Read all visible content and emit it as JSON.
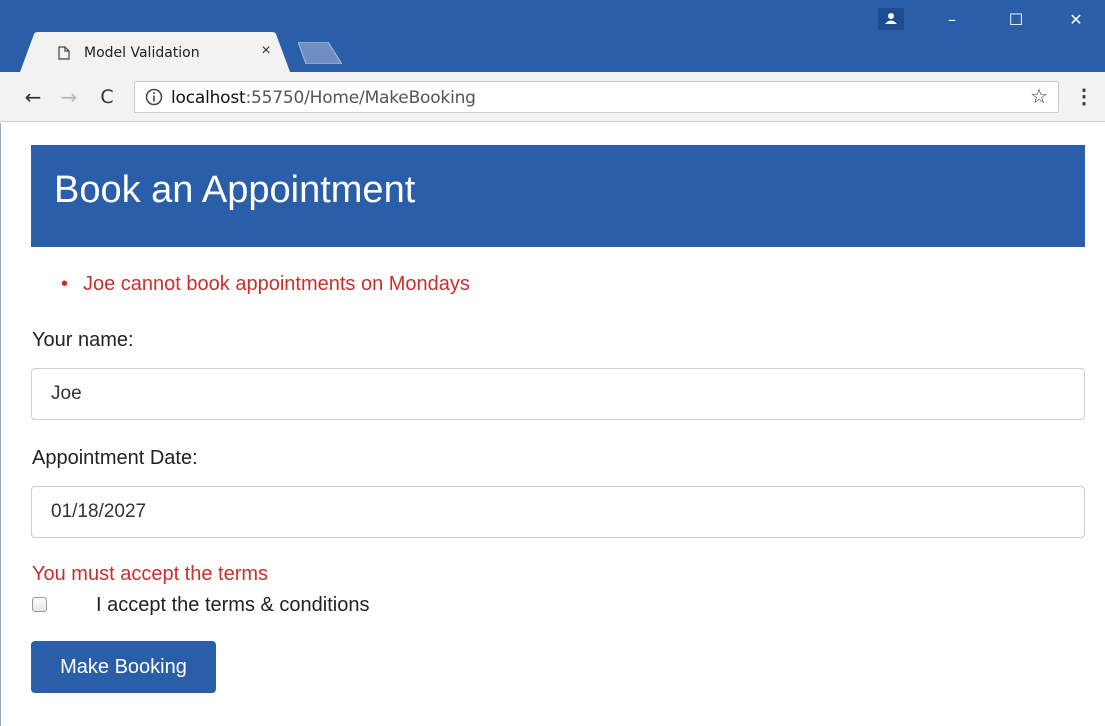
{
  "browser": {
    "tab_title": "Model Validation",
    "tab_close": "×",
    "url_host": "localhost",
    "url_rest": ":55750/Home/MakeBooking",
    "back": "←",
    "forward": "→",
    "reload": "C",
    "bookmark": "☆",
    "menu": "⋮",
    "win_minimize": "–",
    "win_maximize": "☐",
    "win_close": "✕"
  },
  "page": {
    "heading": "Book an Appointment",
    "summary_errors": [
      "Joe cannot book appointments on Mondays"
    ],
    "name_label": "Your name:",
    "name_value": "Joe",
    "date_label": "Appointment Date:",
    "date_value": "01/18/2027",
    "terms_error": "You must accept the terms",
    "terms_label": "I accept the terms & conditions",
    "terms_checked": false,
    "submit_label": "Make Booking"
  },
  "colors": {
    "brand": "#2b5ea8",
    "error": "#c9302c"
  },
  "icons": [
    "page-icon",
    "user-icon",
    "info-icon",
    "star-icon",
    "menu-icon"
  ]
}
